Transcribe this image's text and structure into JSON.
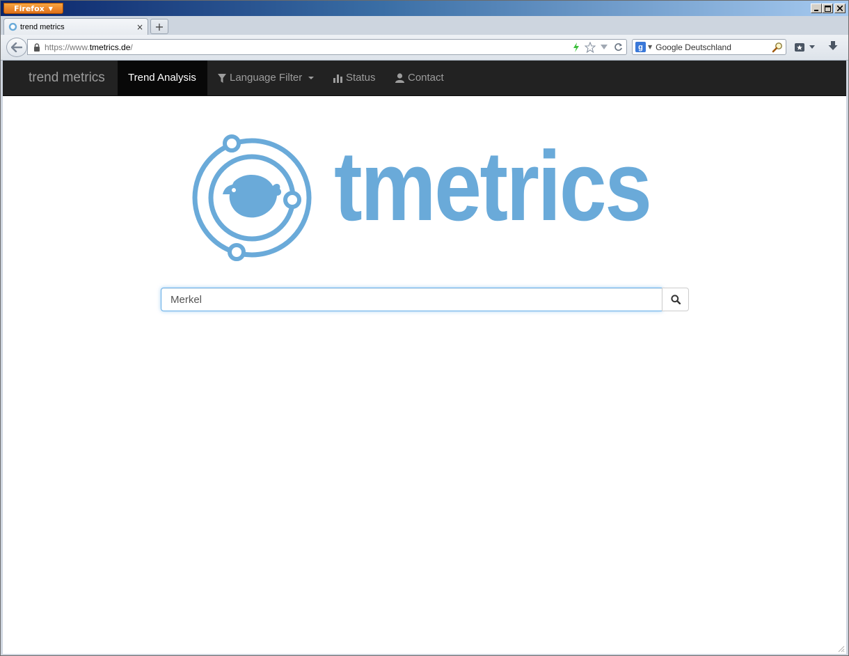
{
  "browser": {
    "app_button_label": "Firefox",
    "window_controls": [
      "0",
      "1",
      "r"
    ],
    "tab": {
      "title": "trend metrics",
      "close_glyph": "×"
    },
    "new_tab_glyph": "+",
    "url": {
      "prefix": "https://www.",
      "domain": "tmetrics.de",
      "suffix": "/"
    },
    "search": {
      "engine_letter": "g",
      "value": "Google Deutschland"
    }
  },
  "site": {
    "brand": "trend metrics",
    "nav": {
      "trend_analysis": "Trend Analysis",
      "language_filter": "Language Filter",
      "status": "Status",
      "contact": "Contact"
    },
    "logo_text": "tmetrics",
    "query": {
      "value": "Merkel"
    }
  },
  "colors": {
    "accent": "#6aaad9",
    "navbar_bg": "#222222",
    "navbar_active": "#080808",
    "focus_border": "#66afe9"
  },
  "icons": [
    "filter-icon",
    "bar-chart-icon",
    "user-icon",
    "search-icon",
    "lock-icon",
    "star-icon",
    "reload-icon",
    "bookmarks-icon",
    "download-icon",
    "back-arrow-icon"
  ]
}
